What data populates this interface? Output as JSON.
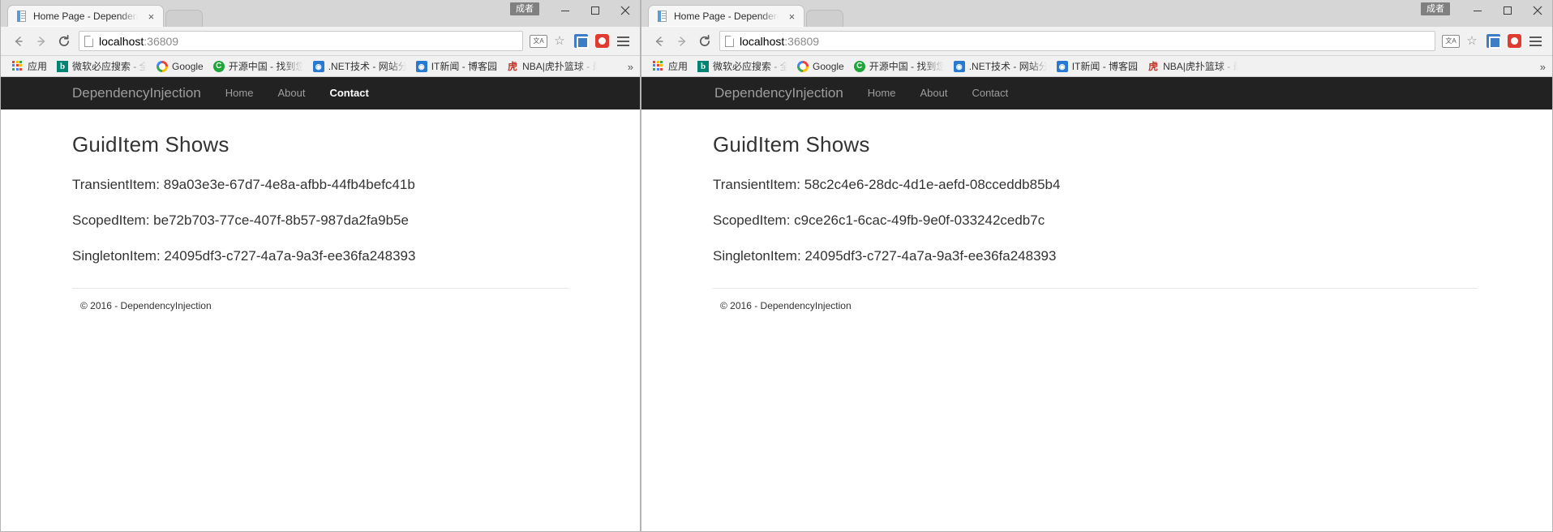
{
  "windows": [
    {
      "id": "left-window",
      "tab": {
        "title": "Home Page - Dependen",
        "favicon": "page-icon",
        "close_label": "×"
      },
      "ime_badge": "成者",
      "toolbar": {
        "back": "←",
        "forward": "→",
        "reload": "⟳",
        "url_host": "localhost",
        "url_port": ":36809",
        "translate_tooltip": "translate-icon",
        "bookmark_star": "☆",
        "menu": "⋮"
      },
      "bookmarks": [
        {
          "label": "应用",
          "icon": "apps-grid-icon"
        },
        {
          "label": "微软必应搜索 - 全球搜",
          "icon": "bing-icon",
          "clipped": true
        },
        {
          "label": "Google",
          "icon": "google-icon"
        },
        {
          "label": "开源中国 - 找到您想要",
          "icon": "oschina-icon",
          "clipped": true
        },
        {
          "label": ".NET技术 - 网站分类",
          "icon": "cnblogs-icon",
          "clipped2": true
        },
        {
          "label": "IT新闻 - 博客园",
          "icon": "cnblogs-icon"
        },
        {
          "label": "NBA|虎扑篮球 - 最盢",
          "icon": "hupu-icon",
          "clipped": true
        }
      ],
      "bookmarks_overflow": "»",
      "site": {
        "brand": "DependencyInjection",
        "nav": [
          {
            "label": "Home",
            "active": false
          },
          {
            "label": "About",
            "active": false
          },
          {
            "label": "Contact",
            "active": true
          }
        ],
        "heading": "GuidItem Shows",
        "lines": [
          "TransientItem: 89a03e3e-67d7-4e8a-afbb-44fb4befc41b",
          "ScopedItem: be72b703-77ce-407f-8b57-987da2fa9b5e",
          "SingletonItem: 24095df3-c727-4a7a-9a3f-ee36fa248393"
        ],
        "footer": "© 2016 - DependencyInjection"
      }
    },
    {
      "id": "right-window",
      "tab": {
        "title": "Home Page - Dependen",
        "favicon": "page-icon",
        "close_label": "×"
      },
      "ime_badge": "成者",
      "toolbar": {
        "back": "←",
        "forward": "→",
        "reload": "⟳",
        "url_host": "localhost",
        "url_port": ":36809",
        "translate_tooltip": "translate-icon",
        "bookmark_star": "☆",
        "menu": "⋮"
      },
      "bookmarks": [
        {
          "label": "应用",
          "icon": "apps-grid-icon"
        },
        {
          "label": "微软必应搜索 - 全球搜",
          "icon": "bing-icon",
          "clipped": true
        },
        {
          "label": "Google",
          "icon": "google-icon"
        },
        {
          "label": "开源中国 - 找到您想要",
          "icon": "oschina-icon",
          "clipped": true
        },
        {
          "label": ".NET技术 - 网站分类",
          "icon": "cnblogs-icon",
          "clipped2": true
        },
        {
          "label": "IT新闻 - 博客园",
          "icon": "cnblogs-icon"
        },
        {
          "label": "NBA|虎扑篮球 - 最盢",
          "icon": "hupu-icon",
          "clipped": true
        }
      ],
      "bookmarks_overflow": "»",
      "site": {
        "brand": "DependencyInjection",
        "nav": [
          {
            "label": "Home",
            "active": false
          },
          {
            "label": "About",
            "active": false
          },
          {
            "label": "Contact",
            "active": false
          }
        ],
        "heading": "GuidItem Shows",
        "lines": [
          "TransientItem: 58c2c4e6-28dc-4d1e-aefd-08cceddb85b4",
          "ScopedItem: c9ce26c1-6cac-49fb-9e0f-033242cedb7c",
          "SingletonItem: 24095df3-c727-4a7a-9a3f-ee36fa248393"
        ],
        "footer": "© 2016 - DependencyInjection"
      }
    }
  ],
  "colors": {
    "navbar_bg": "#222222",
    "navbar_text": "#9d9d9d",
    "navbar_active": "#ffffff",
    "chrome_toolbar": "#f1f1f1",
    "tabstrip": "#d6d6d6",
    "page_text": "#333333"
  }
}
